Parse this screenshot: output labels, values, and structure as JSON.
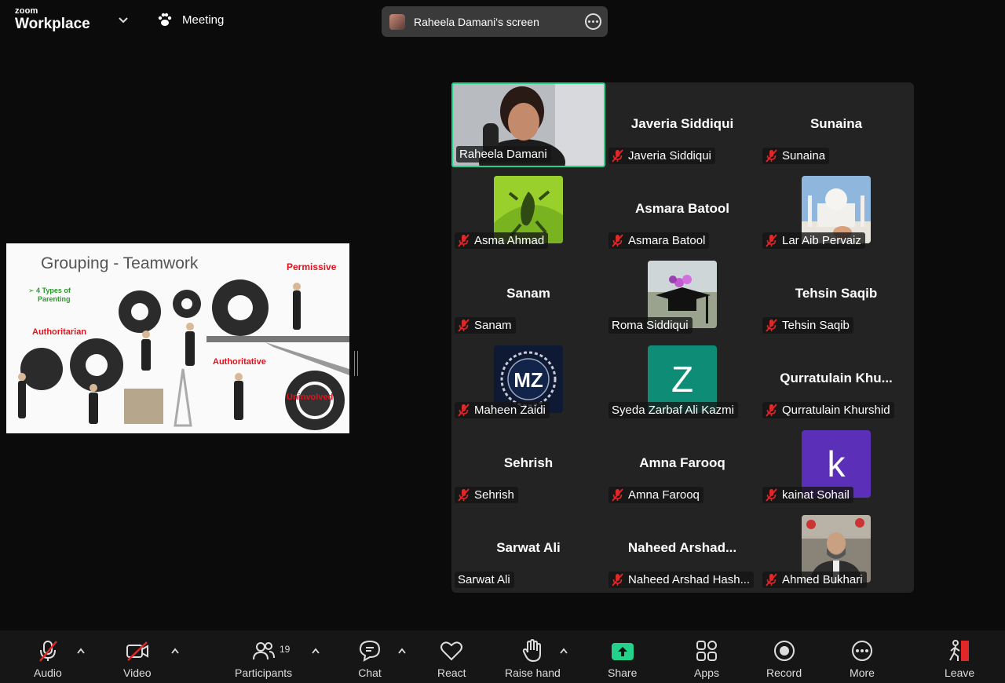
{
  "app": {
    "brand_top": "zoom",
    "brand_bottom": "Workplace",
    "meeting_label": "Meeting",
    "screen_share_label": "Raheela Damani's screen"
  },
  "slide": {
    "title": "Grouping - Teamwork",
    "types_line1": "➢ 4 Types of",
    "types_line2": "Parenting",
    "permissive": "Permissive",
    "authoritarian": "Authoritarian",
    "authoritative": "Authoritative",
    "uninvolved": "Uninvolved"
  },
  "participants": [
    {
      "label": "Raheela Damani",
      "center": "",
      "muted": false,
      "kind": "video"
    },
    {
      "label": "Javeria Siddiqui",
      "center": "Javeria Siddiqui",
      "muted": true,
      "kind": "name"
    },
    {
      "label": "Sunaina",
      "center": "Sunaina",
      "muted": true,
      "kind": "name"
    },
    {
      "label": "Asma Ahmad",
      "center": "",
      "muted": true,
      "kind": "pic-frog"
    },
    {
      "label": "Asmara Batool",
      "center": "Asmara Batool",
      "muted": true,
      "kind": "name"
    },
    {
      "label": "Lar Aib Pervaiz",
      "center": "",
      "muted": true,
      "kind": "pic-mosque"
    },
    {
      "label": "Sanam",
      "center": "Sanam",
      "muted": true,
      "kind": "name"
    },
    {
      "label": "Roma  Siddiqui",
      "center": "",
      "muted": false,
      "kind": "pic-cap"
    },
    {
      "label": "Tehsin Saqib",
      "center": "Tehsin Saqib",
      "muted": true,
      "kind": "name"
    },
    {
      "label": "Maheen Zaidi",
      "center": "",
      "muted": true,
      "kind": "pic-mz"
    },
    {
      "label": "Syeda Zarbaf Ali Kazmi",
      "center": "",
      "muted": false,
      "kind": "initial-z"
    },
    {
      "label": "Qurratulain Khurshid",
      "center": "Qurratulain  Khu...",
      "muted": true,
      "kind": "name"
    },
    {
      "label": "Sehrish",
      "center": "Sehrish",
      "muted": true,
      "kind": "name"
    },
    {
      "label": "Amna Farooq",
      "center": "Amna Farooq",
      "muted": true,
      "kind": "name"
    },
    {
      "label": "kainat Sohail",
      "center": "",
      "muted": true,
      "kind": "initial-k"
    },
    {
      "label": "Sarwat Ali",
      "center": "Sarwat Ali",
      "muted": false,
      "kind": "name"
    },
    {
      "label": "Naheed Arshad Hash...",
      "center": "Naheed  Arshad...",
      "muted": true,
      "kind": "name"
    },
    {
      "label": "Ahmed Bukhari",
      "center": "",
      "muted": true,
      "kind": "pic-man"
    }
  ],
  "initials": {
    "z": "Z",
    "k": "k",
    "mz": "MZ"
  },
  "colors": {
    "accent_green": "#23d18b",
    "share_green": "#23d18b",
    "mute_red": "#e02828",
    "z_tile": "#0e8c75",
    "k_tile": "#5b2fb8"
  },
  "toolbar": {
    "audio": "Audio",
    "video": "Video",
    "participants": "Participants",
    "participants_count": "19",
    "chat": "Chat",
    "react": "React",
    "raise_hand": "Raise hand",
    "share": "Share",
    "apps": "Apps",
    "record": "Record",
    "more": "More",
    "leave": "Leave"
  }
}
